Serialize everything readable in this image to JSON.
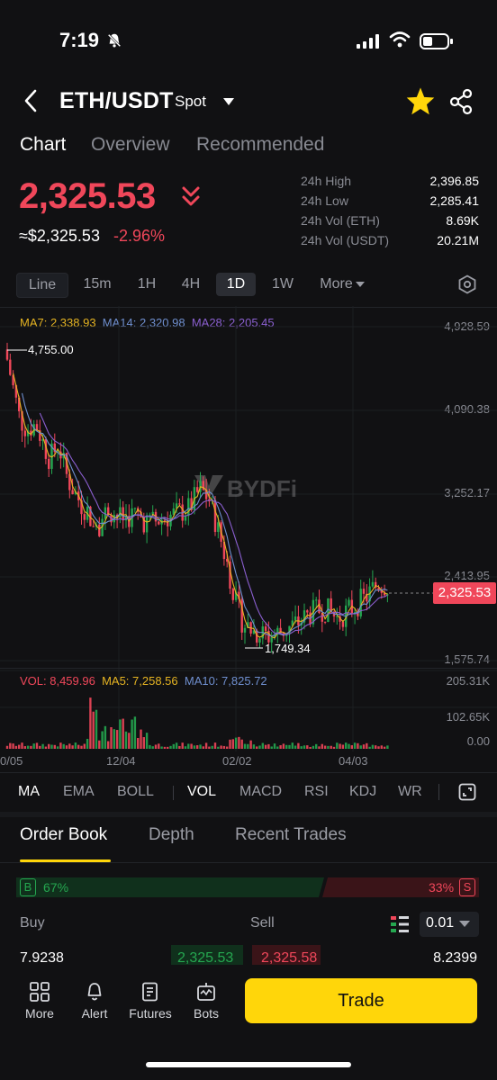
{
  "status_bar": {
    "time": "7:19"
  },
  "header": {
    "pair": "ETH/USDT",
    "market_type": "Spot"
  },
  "tabs": [
    "Chart",
    "Overview",
    "Recommended"
  ],
  "price": {
    "last": "2,325.53",
    "approx": "≈$2,325.53",
    "change_pct": "-2.96%",
    "stats": [
      {
        "label": "24h High",
        "value": "2,396.85"
      },
      {
        "label": "24h Low",
        "value": "2,285.41"
      },
      {
        "label": "24h Vol (ETH)",
        "value": "8.69K"
      },
      {
        "label": "24h Vol (USDT)",
        "value": "20.21M"
      }
    ]
  },
  "timeframes": [
    "Line",
    "15m",
    "1H",
    "4H",
    "1D",
    "1W",
    "More"
  ],
  "chart": {
    "ma_labels": {
      "ma7": "MA7: 2,338.93",
      "ma14": "MA14: 2,320.98",
      "ma28": "MA28: 2,205.45"
    },
    "price_axis": [
      "4,928.59",
      "4,090.38",
      "3,252.17",
      "2,413.95",
      "1,575.74"
    ],
    "high_marker": "4,755.00",
    "low_marker": "1,749.34",
    "current_tag": "2,325.53",
    "watermark": "BYDFi",
    "vol_labels": {
      "vol": "VOL: 8,459.96",
      "ma5": "MA5: 7,258.56",
      "ma10": "MA10: 7,825.72"
    },
    "vol_axis": [
      "205.31K",
      "102.65K",
      "0.00"
    ],
    "dates": [
      "0/05",
      "12/04",
      "02/02",
      "04/03"
    ]
  },
  "indicators": [
    "MA",
    "EMA",
    "BOLL",
    "VOL",
    "MACD",
    "RSI",
    "KDJ",
    "WR"
  ],
  "order_book": {
    "tabs": [
      "Order Book",
      "Depth",
      "Recent Trades"
    ],
    "buy_badge": "B",
    "buy_pct": "67%",
    "sell_badge": "S",
    "sell_pct": "33%",
    "buy_label": "Buy",
    "sell_label": "Sell",
    "step": "0.01",
    "row": {
      "buy_qty": "7.9238",
      "buy_price": "2,325.53",
      "sell_price": "2,325.58",
      "sell_qty": "8.2399"
    }
  },
  "bottom_nav": {
    "items": [
      "More",
      "Alert",
      "Futures",
      "Bots"
    ],
    "trade": "Trade"
  },
  "colors": {
    "up": "#25a750",
    "down": "#f0475a",
    "accent": "#ffd60a",
    "ma7": "#e6b422",
    "ma14": "#6f8fcf",
    "ma28": "#8a5fcf"
  }
}
